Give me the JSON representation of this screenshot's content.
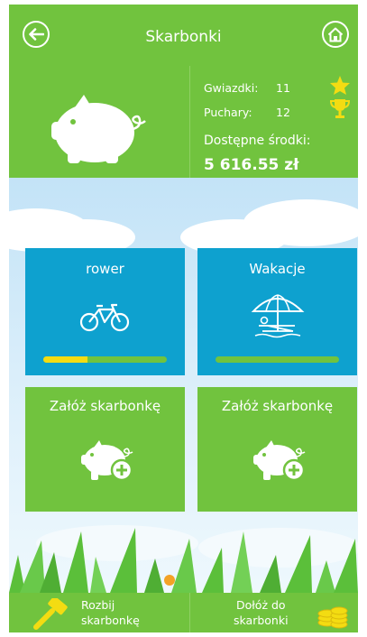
{
  "header": {
    "title": "Skarbonki",
    "back_icon": "arrow-left-icon",
    "home_icon": "home-icon"
  },
  "stats": {
    "stars_label": "Gwiazdki:",
    "stars_value": "11",
    "cups_label": "Puchary:",
    "cups_value": "12",
    "funds_label": "Dostępne środki:",
    "funds_value": "5 616.55 zł"
  },
  "piggy_banks": [
    {
      "name": "rower",
      "icon": "bicycle-icon",
      "progress": 0.36
    },
    {
      "name": "Wakacje",
      "icon": "beach-umbrella-icon",
      "progress": 0
    }
  ],
  "create_tiles": [
    {
      "label": "Załóż skarbonkę"
    },
    {
      "label": "Załóż skarbonkę"
    }
  ],
  "bottom": {
    "break_label": "Rozbij\nskarbonkę",
    "add_label": "Dołóż do\nskarbonki"
  },
  "colors": {
    "green": "#71c33e",
    "blue": "#0ea1cf",
    "yellow": "#f3dc12"
  }
}
